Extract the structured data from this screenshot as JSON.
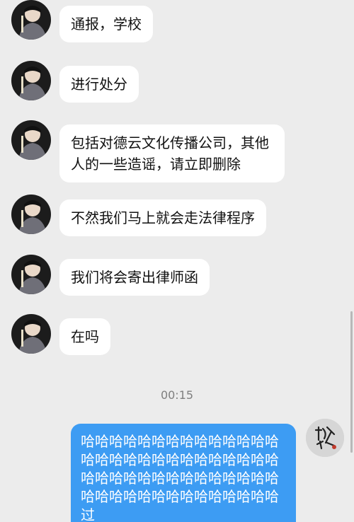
{
  "messages": [
    {
      "text": "通报，学校"
    },
    {
      "text": "进行处分"
    },
    {
      "text": "包括对德云文化传播公司，其他人的一些造谣，请立即删除"
    },
    {
      "text": "不然我们马上就会走法律程序"
    },
    {
      "text": "我们将会寄出律师函"
    },
    {
      "text": "在吗"
    }
  ],
  "timestamp": "00:15",
  "reply": {
    "text": "哈哈哈哈哈哈哈哈哈哈哈哈哈哈哈哈哈哈哈哈哈哈哈哈哈哈哈哈哈哈哈哈哈哈哈哈哈哈哈哈哈哈哈哈哈哈哈哈哈哈哈哈哈哈哈哈过",
    "bubble_color": "#3d9cf3"
  },
  "colors": {
    "background": "#ececec",
    "incoming_bubble": "#ffffff",
    "outgoing_bubble": "#3d9cf3"
  }
}
